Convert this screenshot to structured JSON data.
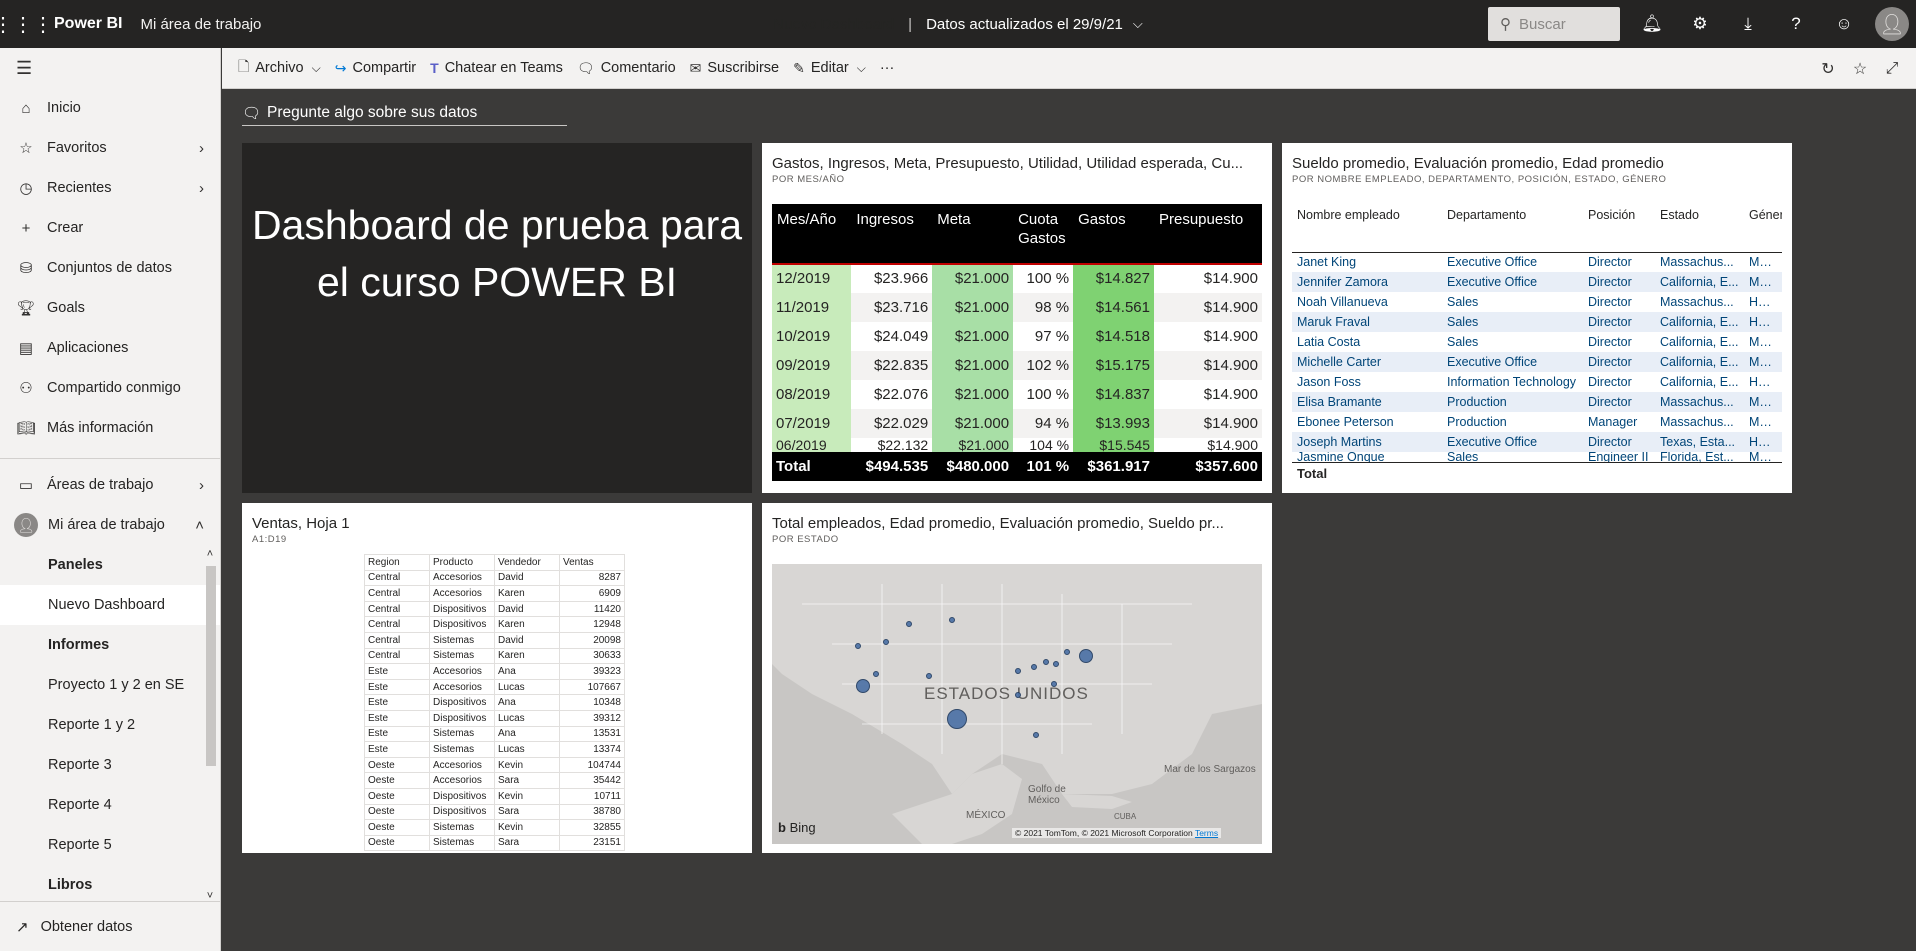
{
  "topbar": {
    "brand": "Power BI",
    "workspace": "Mi área de trabajo",
    "dashboard_title": "Nuevo Dashboard",
    "separator": "|",
    "updated": "Datos actualizados el 29/9/21",
    "search_placeholder": "Buscar"
  },
  "sidebar": {
    "items": [
      {
        "label": "Inicio"
      },
      {
        "label": "Favoritos"
      },
      {
        "label": "Recientes"
      },
      {
        "label": "Crear"
      },
      {
        "label": "Conjuntos de datos"
      },
      {
        "label": "Goals"
      },
      {
        "label": "Aplicaciones"
      },
      {
        "label": "Compartido conmigo"
      },
      {
        "label": "Más información"
      }
    ],
    "workspaces": "Áreas de trabajo",
    "my_workspace": "Mi área de trabajo",
    "sub": {
      "paneles": "Paneles",
      "nuevo_dashboard": "Nuevo Dashboard",
      "informes": "Informes",
      "r1": "Proyecto 1 y 2 en SE",
      "r2": "Reporte 1 y 2",
      "r3": "Reporte 3",
      "r4": "Reporte 4",
      "r5": "Reporte 5",
      "libros": "Libros"
    },
    "get_data": "Obtener datos"
  },
  "commandbar": {
    "archivo": "Archivo",
    "compartir": "Compartir",
    "teams": "Chatear en Teams",
    "comentario": "Comentario",
    "suscribirse": "Suscribirse",
    "editar": "Editar",
    "more": "···"
  },
  "qna": "Pregunte algo sobre sus datos",
  "tile_text": {
    "line1": "Dashboard de prueba para",
    "line2": "el curso POWER BI"
  },
  "tile_finance": {
    "title": "Gastos, Ingresos, Meta, Presupuesto, Utilidad, Utilidad esperada, Cu...",
    "subtitle": "POR MES/AÑO",
    "headers": [
      "Mes/Año",
      "Ingresos",
      "Meta",
      "Cuota Gastos",
      "Gastos",
      "Presupuesto"
    ],
    "rows": [
      [
        "12/2019",
        "$23.966",
        "$21.000",
        "100 %",
        "$14.827",
        "$14.900"
      ],
      [
        "11/2019",
        "$23.716",
        "$21.000",
        "98 %",
        "$14.561",
        "$14.900"
      ],
      [
        "10/2019",
        "$24.049",
        "$21.000",
        "97 %",
        "$14.518",
        "$14.900"
      ],
      [
        "09/2019",
        "$22.835",
        "$21.000",
        "102 %",
        "$15.175",
        "$14.900"
      ],
      [
        "08/2019",
        "$22.076",
        "$21.000",
        "100 %",
        "$14.837",
        "$14.900"
      ],
      [
        "07/2019",
        "$22.029",
        "$21.000",
        "94 %",
        "$13.993",
        "$14.900"
      ],
      [
        "06/2019",
        "$22.132",
        "$21.000",
        "104 %",
        "$15.545",
        "$14.900"
      ]
    ],
    "total": [
      "Total",
      "$494.535",
      "$480.000",
      "101 %",
      "$361.917",
      "$357.600"
    ]
  },
  "tile_employees": {
    "title": "Sueldo promedio, Evaluación promedio, Edad promedio",
    "subtitle": "POR NOMBRE EMPLEADO, DEPARTAMENTO, POSICIÓN, ESTADO, GÉNERO",
    "headers": [
      "Nombre empleado",
      "Departamento",
      "Posición",
      "Estado",
      "Género"
    ],
    "rows": [
      [
        "Janet King",
        "Executive Office",
        "Director",
        "Massachus...",
        "Mujer"
      ],
      [
        "Jennifer Zamora",
        "Executive Office",
        "Director",
        "California, E...",
        "Mujer"
      ],
      [
        "Noah Villanueva",
        "Sales",
        "Director",
        "Massachus...",
        "Hombre"
      ],
      [
        "Maruk Fraval",
        "Sales",
        "Director",
        "California, E...",
        "Hombre"
      ],
      [
        "Latia Costa",
        "Sales",
        "Director",
        "California, E...",
        "Mujer"
      ],
      [
        "Michelle Carter",
        "Executive Office",
        "Director",
        "California, E...",
        "Mujer"
      ],
      [
        "Jason Foss",
        "Information Technology",
        "Director",
        "California, E...",
        "Hombre"
      ],
      [
        "Elisa Bramante",
        "Production",
        "Director",
        "Massachus...",
        "Mujer"
      ],
      [
        "Ebonee Peterson",
        "Production",
        "Manager",
        "Massachus...",
        "Mujer"
      ],
      [
        "Joseph Martins",
        "Executive Office",
        "Director",
        "Texas, Esta...",
        "Hombre"
      ],
      [
        "Jasmine Onque",
        "Sales",
        "Engineer II",
        "Florida, Est...",
        "Mujer"
      ]
    ],
    "total": "Total"
  },
  "tile_excel": {
    "title": "Ventas, Hoja 1",
    "subtitle": "A1:D19",
    "headers": [
      "Region",
      "Producto",
      "Vendedor",
      "Ventas"
    ],
    "rows": [
      [
        "Central",
        "Accesorios",
        "David",
        "8287"
      ],
      [
        "Central",
        "Accesorios",
        "Karen",
        "6909"
      ],
      [
        "Central",
        "Dispositivos",
        "David",
        "11420"
      ],
      [
        "Central",
        "Dispositivos",
        "Karen",
        "12948"
      ],
      [
        "Central",
        "Sistemas",
        "David",
        "20098"
      ],
      [
        "Central",
        "Sistemas",
        "Karen",
        "30633"
      ],
      [
        "Este",
        "Accesorios",
        "Ana",
        "39323"
      ],
      [
        "Este",
        "Accesorios",
        "Lucas",
        "107667"
      ],
      [
        "Este",
        "Dispositivos",
        "Ana",
        "10348"
      ],
      [
        "Este",
        "Dispositivos",
        "Lucas",
        "39312"
      ],
      [
        "Este",
        "Sistemas",
        "Ana",
        "13531"
      ],
      [
        "Este",
        "Sistemas",
        "Lucas",
        "13374"
      ],
      [
        "Oeste",
        "Accesorios",
        "Kevin",
        "104744"
      ],
      [
        "Oeste",
        "Accesorios",
        "Sara",
        "35442"
      ],
      [
        "Oeste",
        "Dispositivos",
        "Kevin",
        "10711"
      ],
      [
        "Oeste",
        "Dispositivos",
        "Sara",
        "38780"
      ],
      [
        "Oeste",
        "Sistemas",
        "Kevin",
        "32855"
      ],
      [
        "Oeste",
        "Sistemas",
        "Sara",
        "23151"
      ]
    ]
  },
  "tile_map": {
    "title": "Total empleados, Edad promedio, Evaluación promedio, Sueldo pr...",
    "subtitle": "POR ESTADO",
    "label_us": "ESTADOS UNIDOS",
    "label_gulf": "Golfo de México",
    "label_mexico": "MÉXICO",
    "label_cuba": "CUBA",
    "label_sargasso": "Mar de los Sargazos",
    "bing": "Bing",
    "copyright": "© 2021 TomTom, © 2021 Microsoft Corporation",
    "terms": "Terms"
  }
}
